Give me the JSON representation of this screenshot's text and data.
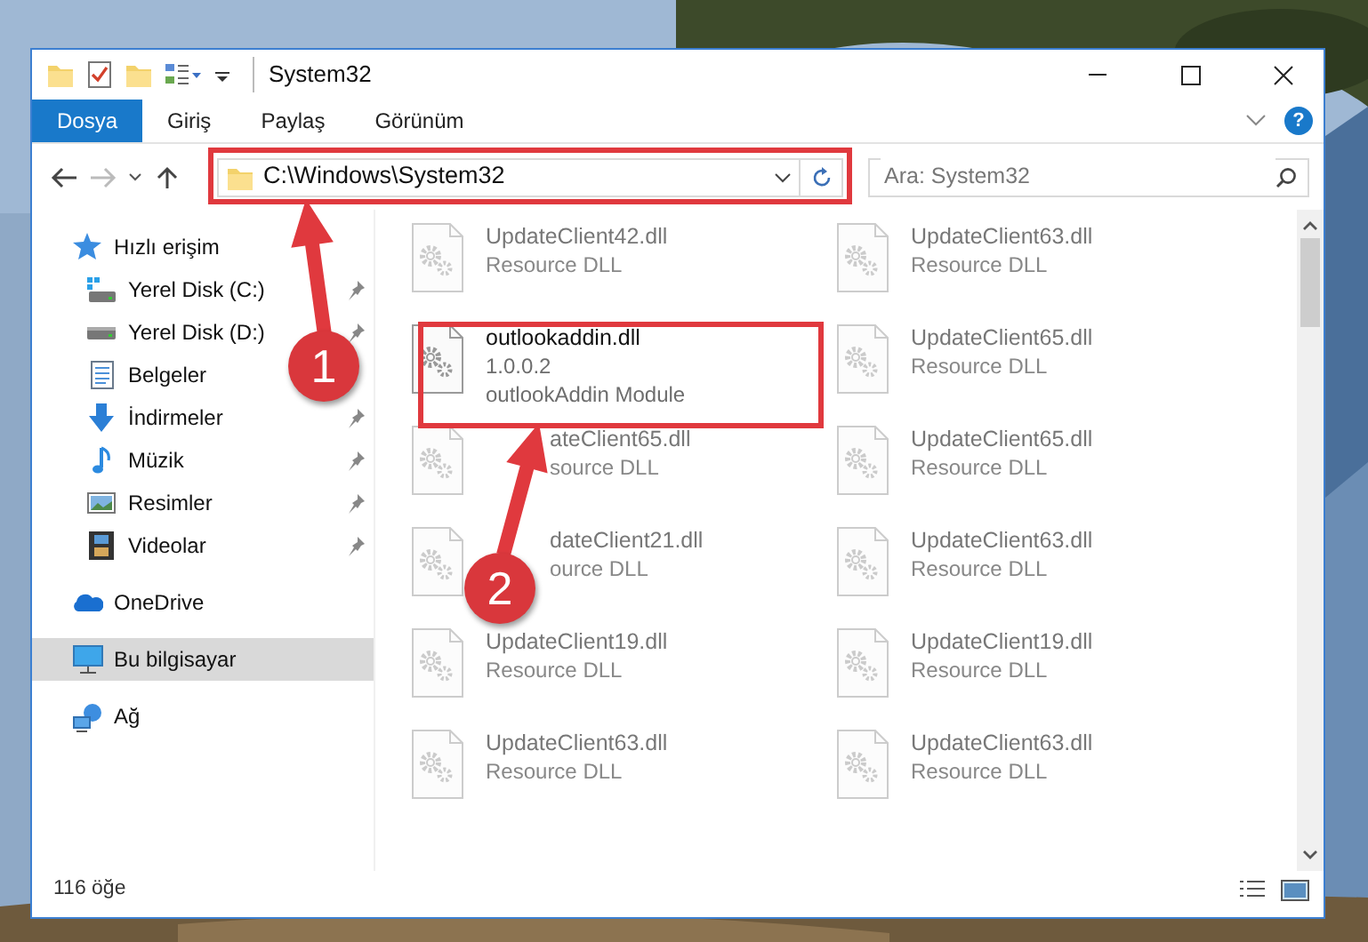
{
  "window": {
    "title": "System32"
  },
  "ribbon": {
    "tabs": [
      {
        "label": "Dosya",
        "selected": true
      },
      {
        "label": "Giriş",
        "selected": false
      },
      {
        "label": "Paylaş",
        "selected": false
      },
      {
        "label": "Görünüm",
        "selected": false
      }
    ],
    "help": "?"
  },
  "navigation": {
    "back_disabled": false,
    "forward_disabled": true
  },
  "address": {
    "path": "C:\\Windows\\System32"
  },
  "search": {
    "placeholder": "Ara: System32"
  },
  "sidebar": {
    "items": [
      {
        "label": "Hızlı erişim",
        "kind": "star",
        "selected": false,
        "children": [
          {
            "label": "Yerel Disk (C:)",
            "kind": "windrive",
            "pinned": true
          },
          {
            "label": "Yerel Disk (D:)",
            "kind": "drive",
            "pinned": true
          },
          {
            "label": "Belgeler",
            "kind": "document",
            "pinned": false
          },
          {
            "label": "İndirmeler",
            "kind": "download",
            "pinned": true
          },
          {
            "label": "Müzik",
            "kind": "music",
            "pinned": true
          },
          {
            "label": "Resimler",
            "kind": "pictures",
            "pinned": true
          },
          {
            "label": "Videolar",
            "kind": "video",
            "pinned": true
          }
        ]
      },
      {
        "label": "OneDrive",
        "kind": "cloud",
        "selected": false
      },
      {
        "label": "Bu bilgisayar",
        "kind": "computer",
        "selected": true
      },
      {
        "label": "Ağ",
        "kind": "network",
        "selected": false
      }
    ]
  },
  "files": [
    {
      "name": "UpdateClient42.dll",
      "details": [
        "Resource DLL"
      ],
      "dimmed": true,
      "covered": false
    },
    {
      "name": "UpdateClient63.dll",
      "details": [
        "Resource DLL"
      ],
      "dimmed": true,
      "covered": false
    },
    {
      "name": "outlookaddin.dll",
      "details": [
        "1.0.0.2",
        "outlookAddin Module"
      ],
      "dimmed": false,
      "covered": false
    },
    {
      "name": "UpdateClient65.dll",
      "details": [
        "Resource DLL"
      ],
      "dimmed": true,
      "covered": false
    },
    {
      "name": "ateClient65.dll",
      "details": [
        "source DLL"
      ],
      "dimmed": true,
      "covered": true
    },
    {
      "name": "UpdateClient65.dll",
      "details": [
        "Resource DLL"
      ],
      "dimmed": true,
      "covered": false
    },
    {
      "name": "dateClient21.dll",
      "details": [
        "ource DLL"
      ],
      "dimmed": true,
      "covered": true
    },
    {
      "name": "UpdateClient63.dll",
      "details": [
        "Resource DLL"
      ],
      "dimmed": true,
      "covered": false
    },
    {
      "name": "UpdateClient19.dll",
      "details": [
        "Resource DLL"
      ],
      "dimmed": true,
      "covered": false
    },
    {
      "name": "UpdateClient19.dll",
      "details": [
        "Resource DLL"
      ],
      "dimmed": true,
      "covered": false
    },
    {
      "name": "UpdateClient63.dll",
      "details": [
        "Resource DLL"
      ],
      "dimmed": true,
      "covered": false
    },
    {
      "name": "UpdateClient63.dll",
      "details": [
        "Resource DLL"
      ],
      "dimmed": true,
      "covered": false
    }
  ],
  "annotations": [
    {
      "label": "1"
    },
    {
      "label": "2"
    }
  ],
  "status_bar": {
    "count": "116 öğe"
  }
}
